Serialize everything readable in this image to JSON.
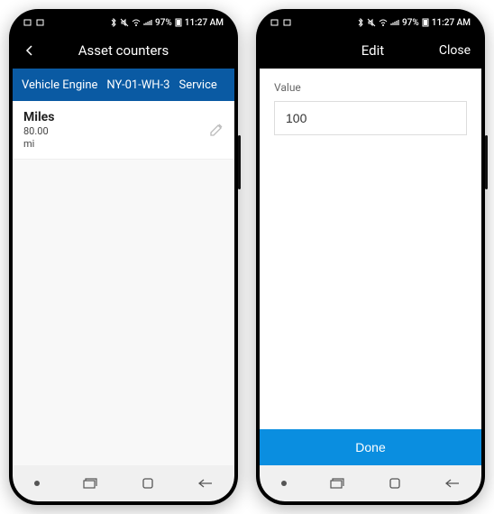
{
  "status": {
    "time": "11:27 AM",
    "battery": "97%"
  },
  "left_phone": {
    "header": {
      "title": "Asset counters"
    },
    "breadcrumb": {
      "part1": "Vehicle Engine",
      "part2": "NY-01-WH-3",
      "part3": "Service"
    },
    "counter": {
      "name": "Miles",
      "value": "80.00",
      "unit": "mi"
    }
  },
  "right_phone": {
    "header": {
      "title": "Edit",
      "close": "Close"
    },
    "form": {
      "label": "Value",
      "value": "100"
    },
    "done": "Done"
  }
}
